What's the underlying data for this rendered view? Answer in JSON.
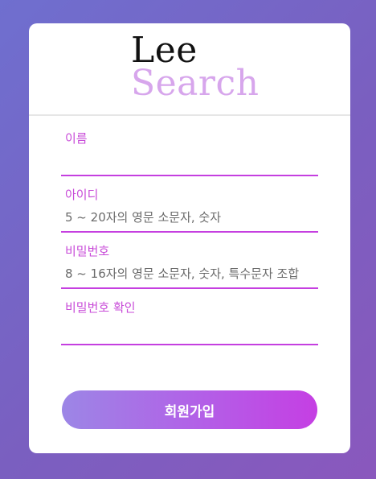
{
  "logo": {
    "line1": "Lee",
    "line2": "Search"
  },
  "form": {
    "fields": [
      {
        "label": "이름",
        "value": "",
        "placeholder": ""
      },
      {
        "label": "아이디",
        "value": "",
        "placeholder": "5 ~ 20자의 영문 소문자, 숫자"
      },
      {
        "label": "비밀번호",
        "value": "",
        "placeholder": "8 ~ 16자의 영문 소문자, 숫자, 특수문자 조합"
      },
      {
        "label": "비밀번호 확인",
        "value": "",
        "placeholder": ""
      }
    ],
    "submit_label": "회원가입"
  },
  "colors": {
    "accent": "#c53fe0",
    "label": "#c84bd8",
    "logo_accent": "#d7a6ec",
    "background_start": "#6f6fcf",
    "background_end": "#8a58bd"
  }
}
